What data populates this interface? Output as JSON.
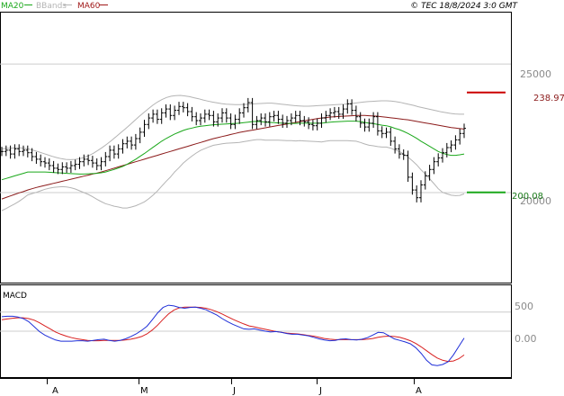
{
  "legend": [
    {
      "name": "MA20",
      "color": "#1aa81a"
    },
    {
      "name": "BBands",
      "color": "#b4b4b4"
    },
    {
      "name": "MA60",
      "color": "#a01818"
    }
  ],
  "copyright": "© TEC 18/8/2024 3:0 GMT",
  "macd_label": "MACD",
  "colors": {
    "price_bar": "#000000",
    "ma20": "#1aa81a",
    "bbands": "#b4b4b4",
    "ma60": "#8b1a1a",
    "macd_line": "#1f2fd8",
    "signal_line": "#d81f1f",
    "resistance": "#cc0000",
    "support": "#1aa81a",
    "grid": "#cccccc"
  },
  "chart_data": [
    {
      "type": "ohlc",
      "panel": "price",
      "x_categories": [
        "A",
        "M",
        "J",
        "J",
        "A"
      ],
      "y_ticks": [
        "25000",
        "20000"
      ],
      "ylim": [
        16500,
        27000
      ],
      "levels": [
        {
          "label": "238.97",
          "value": 23897,
          "kind": "resistance"
        },
        {
          "label": "200.08",
          "value": 20008,
          "kind": "support"
        }
      ],
      "series": [
        {
          "name": "Price",
          "values": [
            21600,
            21650,
            21500,
            21700,
            21600,
            21650,
            21550,
            21400,
            21300,
            21200,
            21150,
            21050,
            20950,
            20900,
            21000,
            20950,
            21050,
            21100,
            21200,
            21300,
            21250,
            21150,
            21050,
            21200,
            21400,
            21650,
            21500,
            21700,
            21900,
            22000,
            21850,
            22100,
            22350,
            22650,
            22900,
            23050,
            22850,
            23100,
            23250,
            23000,
            23200,
            23350,
            23300,
            23150,
            22950,
            22800,
            22900,
            23050,
            23000,
            22750,
            22900,
            23100,
            22900,
            22650,
            22850,
            23100,
            23300,
            23500,
            22650,
            22800,
            22900,
            22750,
            22950,
            23000,
            22850,
            22700,
            22800,
            22900,
            23000,
            22800,
            22750,
            22650,
            22600,
            22700,
            22900,
            23000,
            23100,
            23150,
            23050,
            23250,
            23450,
            23200,
            22950,
            22700,
            22550,
            22700,
            22950,
            22400,
            22300,
            22350,
            22000,
            21700,
            21500,
            21450,
            20600,
            20100,
            19800,
            20300,
            20650,
            20900,
            21200,
            21350,
            21550,
            21750,
            21850,
            22050,
            22300,
            22500
          ]
        },
        {
          "name": "MA20",
          "values": [
            20500,
            20550,
            20600,
            20650,
            20700,
            20750,
            20800,
            20800,
            20800,
            20800,
            20800,
            20790,
            20780,
            20770,
            20760,
            20750,
            20740,
            20730,
            20720,
            20720,
            20730,
            20740,
            20750,
            20770,
            20800,
            20850,
            20900,
            20960,
            21020,
            21100,
            21200,
            21300,
            21410,
            21520,
            21640,
            21760,
            21880,
            22000,
            22100,
            22190,
            22280,
            22350,
            22420,
            22470,
            22510,
            22550,
            22580,
            22600,
            22620,
            22640,
            22650,
            22660,
            22670,
            22680,
            22690,
            22700,
            22720,
            22740,
            22760,
            22770,
            22760,
            22740,
            22730,
            22720,
            22710,
            22700,
            22690,
            22690,
            22690,
            22700,
            22700,
            22700,
            22700,
            22700,
            22700,
            22720,
            22740,
            22750,
            22760,
            22770,
            22780,
            22780,
            22780,
            22760,
            22730,
            22700,
            22680,
            22650,
            22620,
            22600,
            22560,
            22500,
            22450,
            22380,
            22300,
            22210,
            22110,
            22000,
            21900,
            21800,
            21700,
            21600,
            21530,
            21480,
            21450,
            21450,
            21470,
            21500
          ]
        },
        {
          "name": "BBands Upper",
          "values": [
            21700,
            21720,
            21730,
            21740,
            21740,
            21720,
            21690,
            21640,
            21590,
            21530,
            21470,
            21410,
            21360,
            21320,
            21290,
            21280,
            21290,
            21320,
            21370,
            21440,
            21530,
            21640,
            21760,
            21890,
            22030,
            22180,
            22330,
            22480,
            22640,
            22800,
            22960,
            23110,
            23260,
            23400,
            23520,
            23620,
            23700,
            23750,
            23770,
            23780,
            23760,
            23730,
            23690,
            23650,
            23600,
            23560,
            23520,
            23490,
            23460,
            23440,
            23430,
            23420,
            23420,
            23430,
            23440,
            23450,
            23460,
            23470,
            23480,
            23480,
            23460,
            23440,
            23420,
            23400,
            23380,
            23370,
            23360,
            23360,
            23370,
            23380,
            23390,
            23400,
            23410,
            23420,
            23430,
            23440,
            23460,
            23480,
            23500,
            23520,
            23540,
            23550,
            23560,
            23570,
            23570,
            23560,
            23540,
            23510,
            23470,
            23430,
            23390,
            23340,
            23300,
            23260,
            23220,
            23180,
            23140,
            23110,
            23080,
            23060,
            23050,
            23050
          ]
        },
        {
          "name": "BBands Lower",
          "values": [
            19300,
            19380,
            19470,
            19560,
            19660,
            19780,
            19910,
            19960,
            20010,
            20070,
            20130,
            20170,
            20200,
            20220,
            20230,
            20220,
            20190,
            20140,
            20070,
            20000,
            19930,
            19840,
            19740,
            19650,
            19570,
            19520,
            19470,
            19440,
            19400,
            19400,
            19440,
            19490,
            19560,
            19640,
            19760,
            19900,
            20060,
            20250,
            20430,
            20600,
            20800,
            20970,
            21150,
            21290,
            21420,
            21540,
            21640,
            21710,
            21780,
            21840,
            21870,
            21900,
            21920,
            21930,
            21940,
            21950,
            21980,
            22010,
            22040,
            22060,
            22060,
            22040,
            22040,
            22040,
            22040,
            22030,
            22020,
            22020,
            22010,
            22020,
            22010,
            22000,
            21990,
            21980,
            21970,
            22000,
            22020,
            22020,
            22020,
            22020,
            22020,
            22010,
            22000,
            21950,
            21890,
            21840,
            21820,
            21790,
            21770,
            21770,
            21730,
            21660,
            21600,
            21500,
            21380,
            21240,
            21080,
            20890,
            20720,
            20540,
            20350,
            20150,
            20010,
            19950,
            19900,
            19880,
            19890,
            19950
          ]
        },
        {
          "name": "MA60",
          "values": [
            19750,
            19810,
            19870,
            19930,
            19990,
            20040,
            20100,
            20150,
            20200,
            20240,
            20280,
            20320,
            20360,
            20400,
            20440,
            20480,
            20520,
            20560,
            20600,
            20640,
            20680,
            20720,
            20760,
            20800,
            20850,
            20900,
            20950,
            21000,
            21050,
            21100,
            21150,
            21200,
            21250,
            21300,
            21350,
            21400,
            21450,
            21500,
            21550,
            21600,
            21650,
            21700,
            21750,
            21800,
            21850,
            21900,
            21950,
            22000,
            22050,
            22100,
            22140,
            22180,
            22220,
            22260,
            22300,
            22340,
            22370,
            22400,
            22430,
            22460,
            22490,
            22520,
            22550,
            22580,
            22610,
            22640,
            22670,
            22700,
            22730,
            22760,
            22790,
            22820,
            22850,
            22880,
            22900,
            22920,
            22940,
            22950,
            22960,
            22970,
            22980,
            22990,
            23000,
            23000,
            23000,
            22990,
            22980,
            22970,
            22950,
            22930,
            22910,
            22890,
            22870,
            22850,
            22830,
            22800,
            22770,
            22740,
            22710,
            22680,
            22650,
            22620,
            22590,
            22560,
            22530,
            22510,
            22490,
            22470
          ]
        }
      ]
    },
    {
      "type": "line",
      "panel": "macd",
      "y_ticks": [
        "500",
        "0.00"
      ],
      "ylim": [
        -1200,
        1200
      ],
      "series": [
        {
          "name": "MACD",
          "values": [
            380,
            390,
            390,
            370,
            330,
            250,
            120,
            -10,
            -100,
            -170,
            -230,
            -260,
            -260,
            -260,
            -250,
            -250,
            -260,
            -240,
            -220,
            -210,
            -240,
            -260,
            -240,
            -200,
            -140,
            -70,
            20,
            130,
            300,
            480,
            620,
            680,
            660,
            620,
            600,
            620,
            630,
            600,
            560,
            490,
            420,
            330,
            250,
            180,
            120,
            60,
            50,
            60,
            30,
            0,
            -20,
            -10,
            -30,
            -60,
            -80,
            -80,
            -100,
            -120,
            -160,
            -200,
            -230,
            -250,
            -240,
            -210,
            -200,
            -220,
            -230,
            -210,
            -170,
            -100,
            -30,
            -40,
            -120,
            -200,
            -240,
            -280,
            -330,
            -430,
            -580,
            -760,
            -880,
            -900,
            -870,
            -800,
            -620,
            -400,
            -180
          ]
        },
        {
          "name": "Signal",
          "values": [
            300,
            320,
            340,
            350,
            350,
            330,
            290,
            220,
            140,
            60,
            -20,
            -80,
            -130,
            -170,
            -200,
            -220,
            -240,
            -250,
            -250,
            -240,
            -240,
            -240,
            -240,
            -230,
            -210,
            -180,
            -140,
            -70,
            30,
            160,
            310,
            450,
            550,
            610,
            630,
            630,
            630,
            620,
            600,
            560,
            510,
            450,
            380,
            310,
            250,
            190,
            140,
            110,
            80,
            50,
            20,
            -10,
            -30,
            -50,
            -60,
            -70,
            -90,
            -110,
            -130,
            -160,
            -190,
            -210,
            -220,
            -220,
            -220,
            -220,
            -220,
            -220,
            -210,
            -190,
            -160,
            -140,
            -130,
            -140,
            -160,
            -200,
            -250,
            -320,
            -410,
            -510,
            -610,
            -700,
            -760,
            -790,
            -780,
            -720,
            -620
          ]
        }
      ]
    }
  ]
}
